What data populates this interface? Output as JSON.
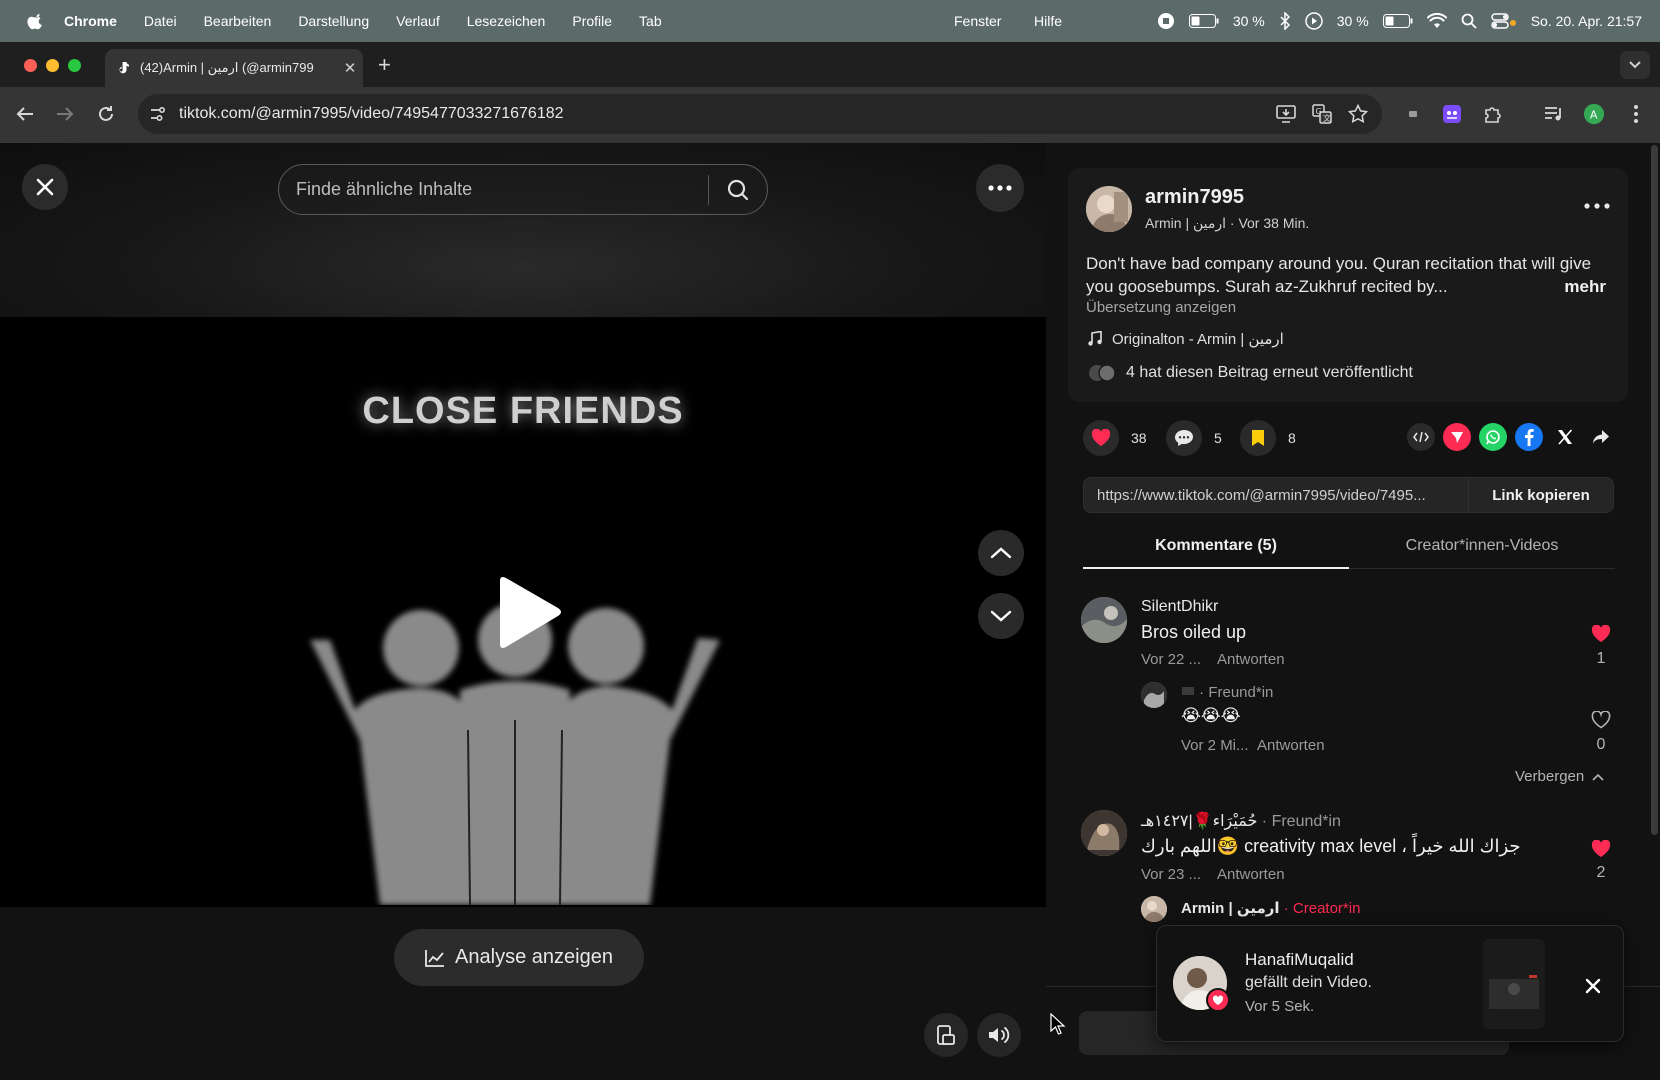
{
  "menubar": {
    "app": "Chrome",
    "items": [
      "Datei",
      "Bearbeiten",
      "Darstellung",
      "Verlauf",
      "Lesezeichen",
      "Profile",
      "Tab"
    ],
    "right_items": [
      "Fenster",
      "Hilfe"
    ],
    "battery_percent_1": "30 %",
    "battery_percent_2": "30 %",
    "datetime": "So. 20. Apr. 21:57"
  },
  "browser": {
    "tab_title": "(42)Armin | ارمين (@armin799",
    "url": "tiktok.com/@armin7995/video/7495477033271676182"
  },
  "video": {
    "search_placeholder": "Finde ähnliche Inhalte",
    "caption": "CLOSE FRIENDS",
    "analyse_label": "Analyse anzeigen"
  },
  "post": {
    "username": "armin7995",
    "subline": "Armin | ارمين · Vor 38 Min.",
    "description": "Don't have bad company around you. Quran recitation that will give you goosebumps. Surah az-Zukhruf recited by...",
    "more": "mehr",
    "translate": "Übersetzung anzeigen",
    "sound": "Originalton - Armin | ارمين",
    "reposts": "4 hat diesen Beitrag erneut veröffentlicht",
    "likes": "38",
    "comments": "5",
    "saves": "8",
    "link": "https://www.tiktok.com/@armin7995/video/7495...",
    "copy_link": "Link kopieren"
  },
  "tabs": {
    "comments": "Kommentare (5)",
    "creator_videos": "Creator*innen-Videos"
  },
  "comments": [
    {
      "name": "SilentDhikr",
      "text": "Bros oiled up",
      "time": "Vor 22 ...",
      "reply": "Antworten",
      "likes": "1"
    },
    {
      "name_suffix": "· Freund*in",
      "text": "😭😭😭",
      "time": "Vor 2 Mi...",
      "reply": "Antworten",
      "likes": "0"
    },
    {
      "name": "حُمَيْرَاء🌹|١٤٢٧هـ",
      "name_suffix": "· Freund*in",
      "text": "جزاك الله خيراً ، creativity max level 🤓اللهم بارك",
      "time": "Vor 23 ...",
      "reply": "Antworten",
      "likes": "2"
    },
    {
      "name": "Armin | ارمين",
      "name_suffix": "· Creator*in"
    }
  ],
  "hide_label": "Verbergen",
  "toast": {
    "name": "HanafiMuqalid",
    "message": "gefällt dein Video.",
    "time": "Vor 5 Sek."
  },
  "colors": {
    "accent": "#fe2c55",
    "panel_bg": "#121212",
    "card_bg": "#1a1a1a",
    "saved_yellow": "#facd0c"
  }
}
